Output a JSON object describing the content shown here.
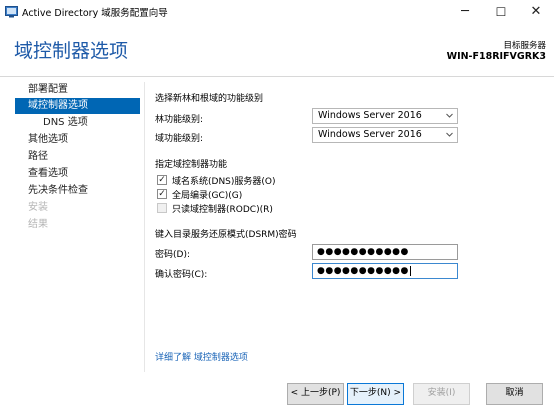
{
  "window": {
    "title": "Active Directory 域服务配置向导",
    "minimize": "─",
    "maximize": "☐",
    "close": "✕"
  },
  "header": {
    "title": "域控制器选项",
    "target_label": "目标服务器",
    "target_name": "WIN-F18RIFVGRK3"
  },
  "nav": {
    "items": [
      {
        "label": "部署配置"
      },
      {
        "label": "域控制器选项"
      },
      {
        "label": "DNS 选项"
      },
      {
        "label": "其他选项"
      },
      {
        "label": "路径"
      },
      {
        "label": "查看选项"
      },
      {
        "label": "先决条件检查"
      },
      {
        "label": "安装"
      },
      {
        "label": "结果"
      }
    ]
  },
  "form": {
    "functional_level_heading": "选择新林和根域的功能级别",
    "forest_level_label": "林功能级别:",
    "forest_level_value": "Windows Server 2016",
    "domain_level_label": "域功能级别:",
    "domain_level_value": "Windows Server 2016",
    "dc_capabilities_heading": "指定域控制器功能",
    "dns_label": "域名系统(DNS)服务器(O)",
    "dns_checked": true,
    "gc_label": "全局编录(GC)(G)",
    "gc_checked": true,
    "rodc_label": "只读域控制器(RODC)(R)",
    "rodc_checked": false,
    "dsrm_heading": "键入目录服务还原模式(DSRM)密码",
    "password_label": "密码(D):",
    "password_value": "●●●●●●●●●●●",
    "confirm_label": "确认密码(C):",
    "confirm_value": "●●●●●●●●●●●",
    "check_mark": "✓"
  },
  "learn_more": "详细了解 域控制器选项",
  "buttons": {
    "back": "< 上一步(P)",
    "next": "下一步(N) >",
    "install": "安装(I)",
    "cancel": "取消"
  }
}
